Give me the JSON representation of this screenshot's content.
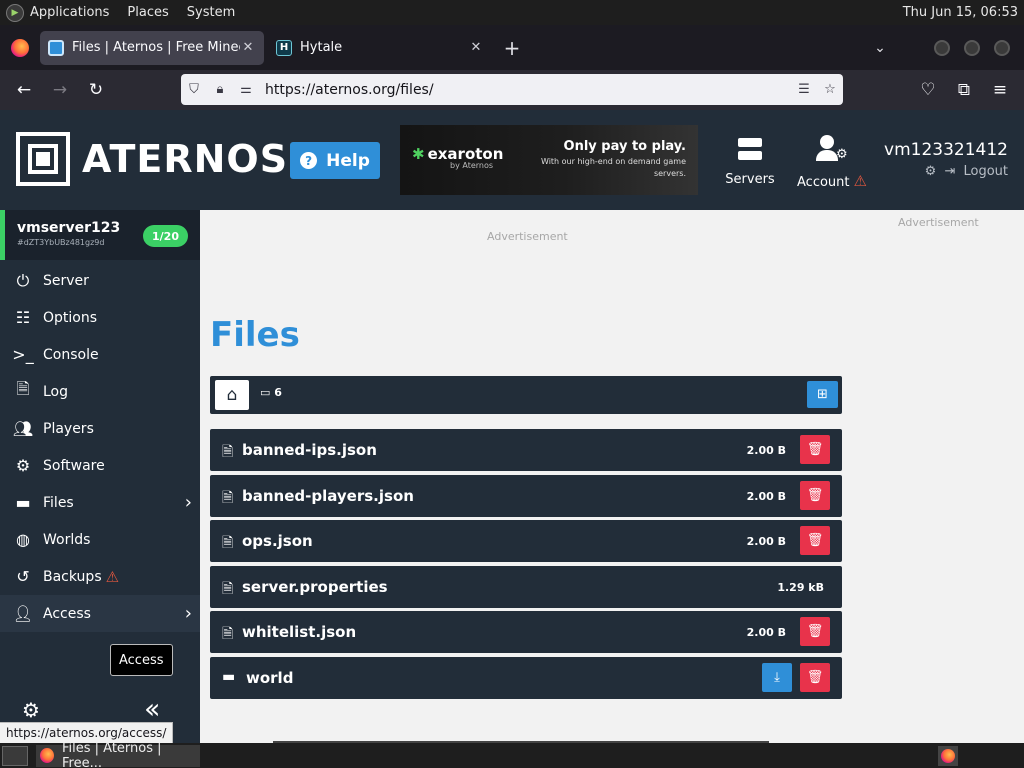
{
  "gnome_panel": {
    "menus": [
      "Applications",
      "Places",
      "System"
    ],
    "clock": "Thu Jun 15, 06:53"
  },
  "browser": {
    "tabs": [
      {
        "title": "Files | Aternos | Free Minecraft",
        "active": true,
        "favicon": "aternos-icon"
      },
      {
        "title": "Hytale",
        "active": false,
        "favicon": "hytale-icon"
      }
    ],
    "url": "https://aternos.org/files/",
    "status_url": "https://aternos.org/access/"
  },
  "header": {
    "brand": "ATERNOS",
    "help_label": "Help",
    "ad": {
      "brand": "exaroton",
      "by": "by Aternos",
      "slogan": "Only pay to play.",
      "text": "With our high-end on demand game servers."
    },
    "nav": {
      "servers": "Servers",
      "account": "Account"
    },
    "username": "vm123321412",
    "logout": "Logout"
  },
  "sidebar": {
    "server_name": "vmserver123",
    "server_id": "#dZT3YbUBz481gz9d",
    "players_badge": "1/20",
    "items": [
      {
        "label": "Server",
        "icon": "power-icon"
      },
      {
        "label": "Options",
        "icon": "sliders-icon"
      },
      {
        "label": "Console",
        "icon": "terminal-icon"
      },
      {
        "label": "Log",
        "icon": "document-icon"
      },
      {
        "label": "Players",
        "icon": "users-icon"
      },
      {
        "label": "Software",
        "icon": "gears-icon"
      },
      {
        "label": "Files",
        "icon": "folder-icon"
      },
      {
        "label": "Worlds",
        "icon": "globe-icon"
      },
      {
        "label": "Backups",
        "icon": "history-icon"
      },
      {
        "label": "Access",
        "icon": "user-lock-icon"
      }
    ],
    "tooltip": "Access"
  },
  "main": {
    "ad_label": "Advertisement",
    "title": "Files",
    "breadcrumb_count": "6",
    "files": [
      {
        "name": "banned-ips.json",
        "size": "2.00 B",
        "type": "file",
        "deletable": true
      },
      {
        "name": "banned-players.json",
        "size": "2.00 B",
        "type": "file",
        "deletable": true
      },
      {
        "name": "ops.json",
        "size": "2.00 B",
        "type": "file",
        "deletable": true
      },
      {
        "name": "server.properties",
        "size": "1.29 kB",
        "type": "config",
        "deletable": false
      },
      {
        "name": "whitelist.json",
        "size": "2.00 B",
        "type": "file",
        "deletable": true
      },
      {
        "name": "world",
        "size": "",
        "type": "folder",
        "deletable": true
      }
    ]
  },
  "taskbar": {
    "task_title": "Files | Aternos | Free..."
  },
  "colors": {
    "dark": "#222d39",
    "accent_blue": "#2f8fd8",
    "danger_red": "#e8334b",
    "online_green": "#3bd065",
    "warning": "#e0573f"
  }
}
